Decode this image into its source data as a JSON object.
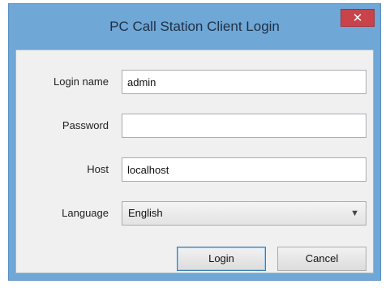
{
  "window": {
    "title": "PC Call Station Client Login",
    "close_label": "✕"
  },
  "form": {
    "login_name_label": "Login name",
    "login_name_value": "admin",
    "password_label": "Password",
    "password_value": "",
    "host_label": "Host",
    "host_value": "localhost",
    "language_label": "Language",
    "language_value": "English"
  },
  "buttons": {
    "login_label": "Login",
    "cancel_label": "Cancel"
  },
  "icons": {
    "close": "close-icon",
    "dropdown": "chevron-down-icon"
  }
}
